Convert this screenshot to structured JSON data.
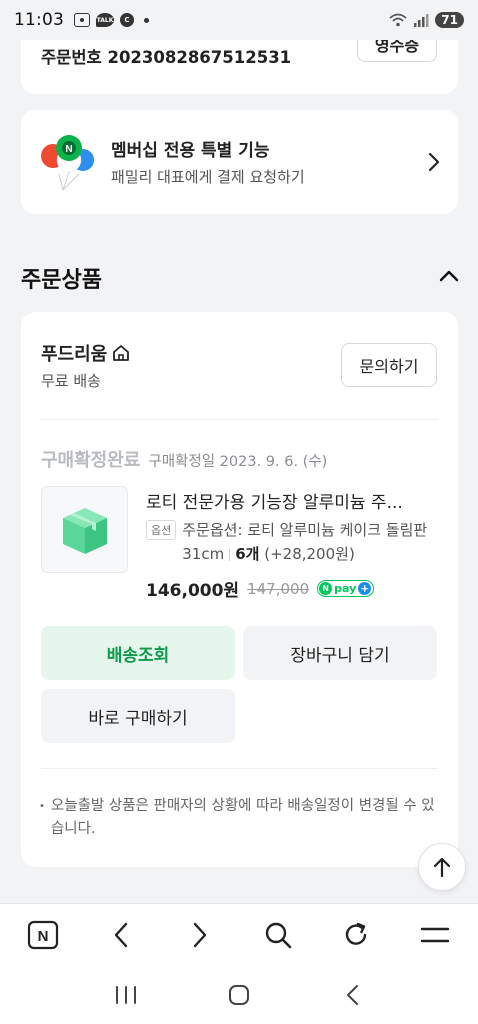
{
  "status_bar": {
    "time": "11:03",
    "battery": "71",
    "icons": [
      "screenshot-icon",
      "kakaotalk-icon",
      "c-icon",
      "dot-icon",
      "wifi-icon",
      "signal-icon",
      "battery-icon"
    ]
  },
  "order": {
    "number_label": "주문번호 2023082867512531",
    "receipt_label": "영수증"
  },
  "membership": {
    "title": "멤버십 전용 특별 기능",
    "subtitle": "패밀리 대표에게 결제 요청하기",
    "balloon_label": "N"
  },
  "section": {
    "title": "주문상품"
  },
  "seller": {
    "name": "푸드리움",
    "shipping": "무료 배송",
    "inquiry_label": "문의하기"
  },
  "product": {
    "status": "구매확정완료",
    "confirm_date": "구매확정일 2023. 9. 6. (수)",
    "name": "로티 전문가용 기능장 알루미늄 주...",
    "option_tag": "옵션",
    "option_text": "주문옵션: 로티 알루미늄 케이크 돌림판 31cm",
    "quantity": "6개",
    "extra_price": "(+28,200원)",
    "price": "146,000원",
    "original_price": "147,000",
    "npay_n": "N",
    "npay_text": "pay",
    "npay_plus": "+"
  },
  "actions": {
    "track": "배송조회",
    "cart": "장바구니 담기",
    "buy": "바로 구매하기"
  },
  "notice": {
    "bullet": "•",
    "text": "오늘출발 상품은 판매자의 상황에 따라 배송일정이 변경될 수 있습니다."
  },
  "browser_bar": {
    "naver_label": "N"
  },
  "colors": {
    "naver_green": "#03c75a",
    "track_bg": "#e5f7ec",
    "track_text": "#0e9a4a",
    "page_bg": "#f2f3f5"
  }
}
